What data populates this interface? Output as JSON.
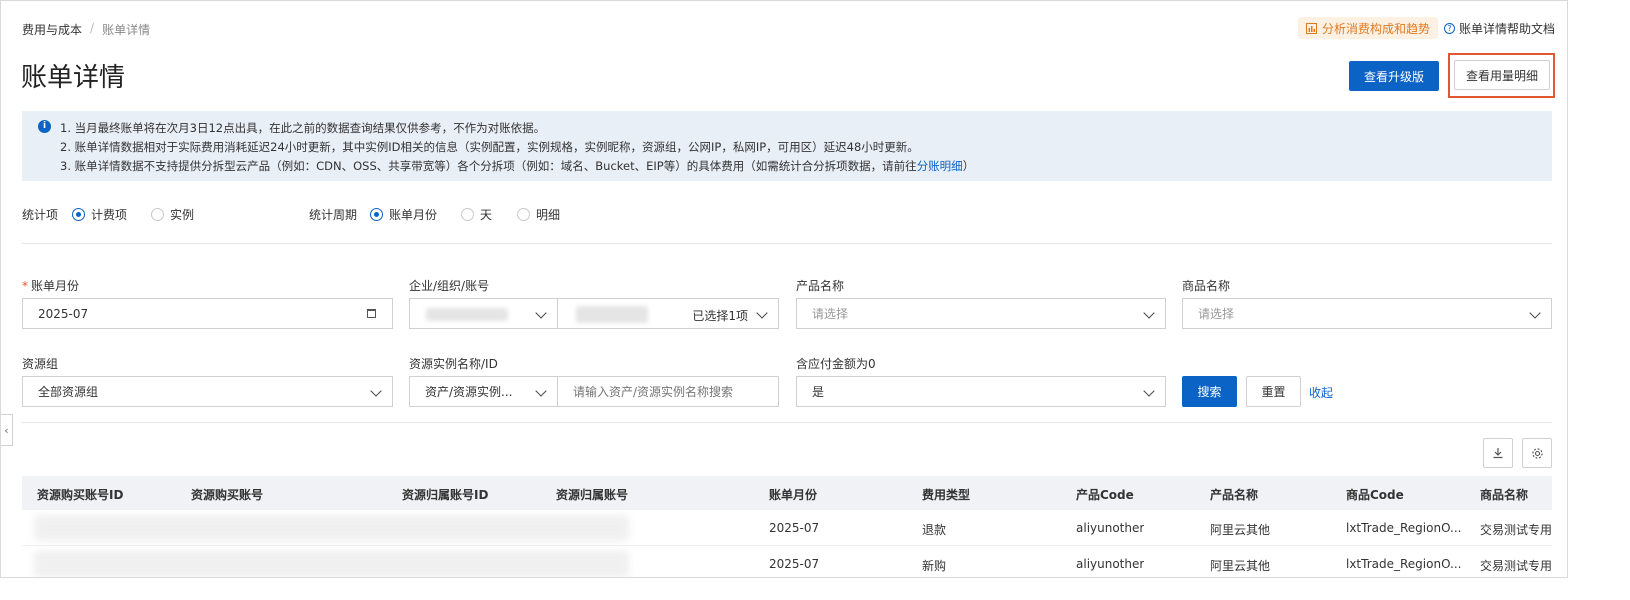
{
  "breadcrumb": {
    "parent": "费用与成本",
    "separator": "/",
    "current": "账单详情"
  },
  "header": {
    "analysis_link": "分析消费构成和趋势",
    "help_link": "账单详情帮助文档",
    "title": "账单详情",
    "upgrade_button": "查看升级版",
    "usage_button": "查看用量明细"
  },
  "notice": {
    "line1": "1. 当月最终账单将在次月3日12点出具，在此之前的数据查询结果仅供参考，不作为对账依据。",
    "line2": "2. 账单详情数据相对于实际费用消耗延迟24小时更新，其中实例ID相关的信息（实例配置，实例规格，实例昵称，资源组，公网IP，私网IP，可用区）延迟48小时更新。",
    "line3_prefix": "3. 账单详情数据不支持提供分拆型云产品（例如：CDN、OSS、共享带宽等）各个分拆项（例如：域名、Bucket、EIP等）的具体费用（如需统计合分拆项数据，请前往",
    "line3_link": "分账明细",
    "line3_suffix": "）"
  },
  "stat_item": {
    "label": "统计项",
    "options": [
      "计费项",
      "实例"
    ],
    "selected": 0
  },
  "stat_period": {
    "label": "统计周期",
    "options": [
      "账单月份",
      "天",
      "明细"
    ],
    "selected": 0
  },
  "filters": {
    "bill_month": {
      "label": "账单月份",
      "required_mark": "*",
      "value": "2025-07"
    },
    "account": {
      "label": "企业/组织/账号",
      "selected_count": "已选择1项"
    },
    "product_name": {
      "label": "产品名称",
      "placeholder": "请选择"
    },
    "goods_name": {
      "label": "商品名称",
      "placeholder": "请选择"
    },
    "resource_group": {
      "label": "资源组",
      "value": "全部资源组"
    },
    "instance": {
      "label": "资源实例名称/ID",
      "type_value": "资产/资源实例...",
      "placeholder": "请输入资产/资源实例名称搜索"
    },
    "zero_amount": {
      "label": "含应付金额为0",
      "value": "是"
    },
    "search_button": "搜索",
    "reset_button": "重置",
    "collapse_link": "收起"
  },
  "table": {
    "columns": [
      "资源购买账号ID",
      "资源购买账号",
      "资源归属账号ID",
      "资源归属账号",
      "账单月份",
      "费用类型",
      "产品Code",
      "产品名称",
      "商品Code",
      "商品名称"
    ],
    "rows": [
      {
        "bill_month": "2025-07",
        "fee_type": "退款",
        "product_code": "aliyunother",
        "product_name": "阿里云其他",
        "goods_code": "lxtTrade_RegionO...",
        "goods_name": "交易测试专用-"
      },
      {
        "bill_month": "2025-07",
        "fee_type": "新购",
        "product_code": "aliyunother",
        "product_name": "阿里云其他",
        "goods_code": "lxtTrade_RegionO...",
        "goods_name": "交易测试专用-"
      }
    ]
  },
  "icons": {
    "download": "download-icon",
    "settings": "gear-icon",
    "info": "info-icon",
    "chart": "bar-chart-icon",
    "help": "question-icon",
    "calendar": "calendar-icon"
  },
  "colors": {
    "primary": "#0b63c5",
    "highlight_border": "#e2572f",
    "analysis_text": "#e07a1f",
    "notice_bg": "#e9eff7"
  }
}
